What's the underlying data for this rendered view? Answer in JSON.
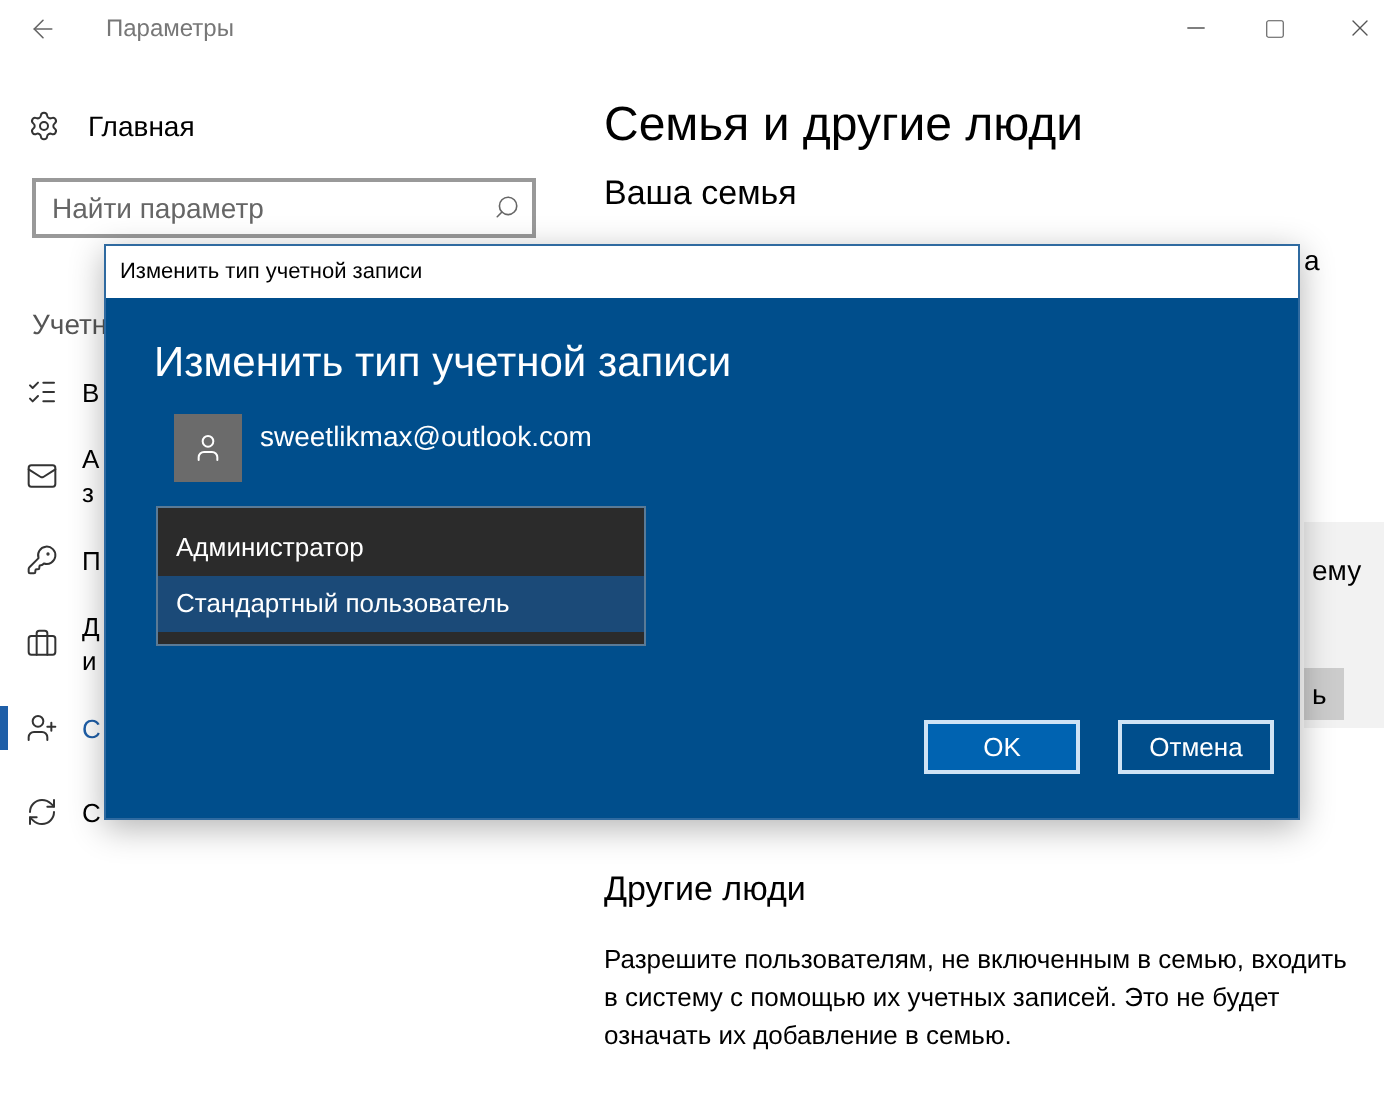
{
  "window": {
    "title": "Параметры"
  },
  "sidebar": {
    "home": "Главная",
    "search": {
      "placeholder": "Найти параметр"
    },
    "section_label": "Учетн",
    "items": [
      {
        "kind": "info",
        "lines": [
          "В"
        ],
        "selected": false
      },
      {
        "kind": "mail",
        "lines": [
          "А",
          "з"
        ],
        "selected": false
      },
      {
        "kind": "signin",
        "lines": [
          "П"
        ],
        "selected": false
      },
      {
        "kind": "work",
        "lines": [
          "Д",
          "и"
        ],
        "selected": false
      },
      {
        "kind": "family",
        "lines": [
          "С"
        ],
        "selected": true
      },
      {
        "kind": "sync",
        "lines": [
          "С"
        ],
        "selected": false
      }
    ]
  },
  "main": {
    "title": "Семья и другие люди",
    "family_heading": "Ваша семья",
    "family_fragment": "а",
    "panel_fragment": "ему",
    "button_fragment": "ь",
    "other_heading": "Другие люди",
    "other_text": "Разрешите пользователям, не включенным в семью, входить в систему с помощью их учетных записей. Это не будет означать их добавление в семью."
  },
  "dialog": {
    "title": "Изменить тип учетной записи",
    "heading": "Изменить тип учетной записи",
    "account": "sweetlikmax@outlook.com",
    "options": [
      {
        "label": "Администратор",
        "selected": false
      },
      {
        "label": "Стандартный пользователь",
        "selected": true
      }
    ],
    "buttons": [
      {
        "label": "OK",
        "kind": "primary"
      },
      {
        "label": "Отмена",
        "kind": "secondary"
      }
    ]
  }
}
